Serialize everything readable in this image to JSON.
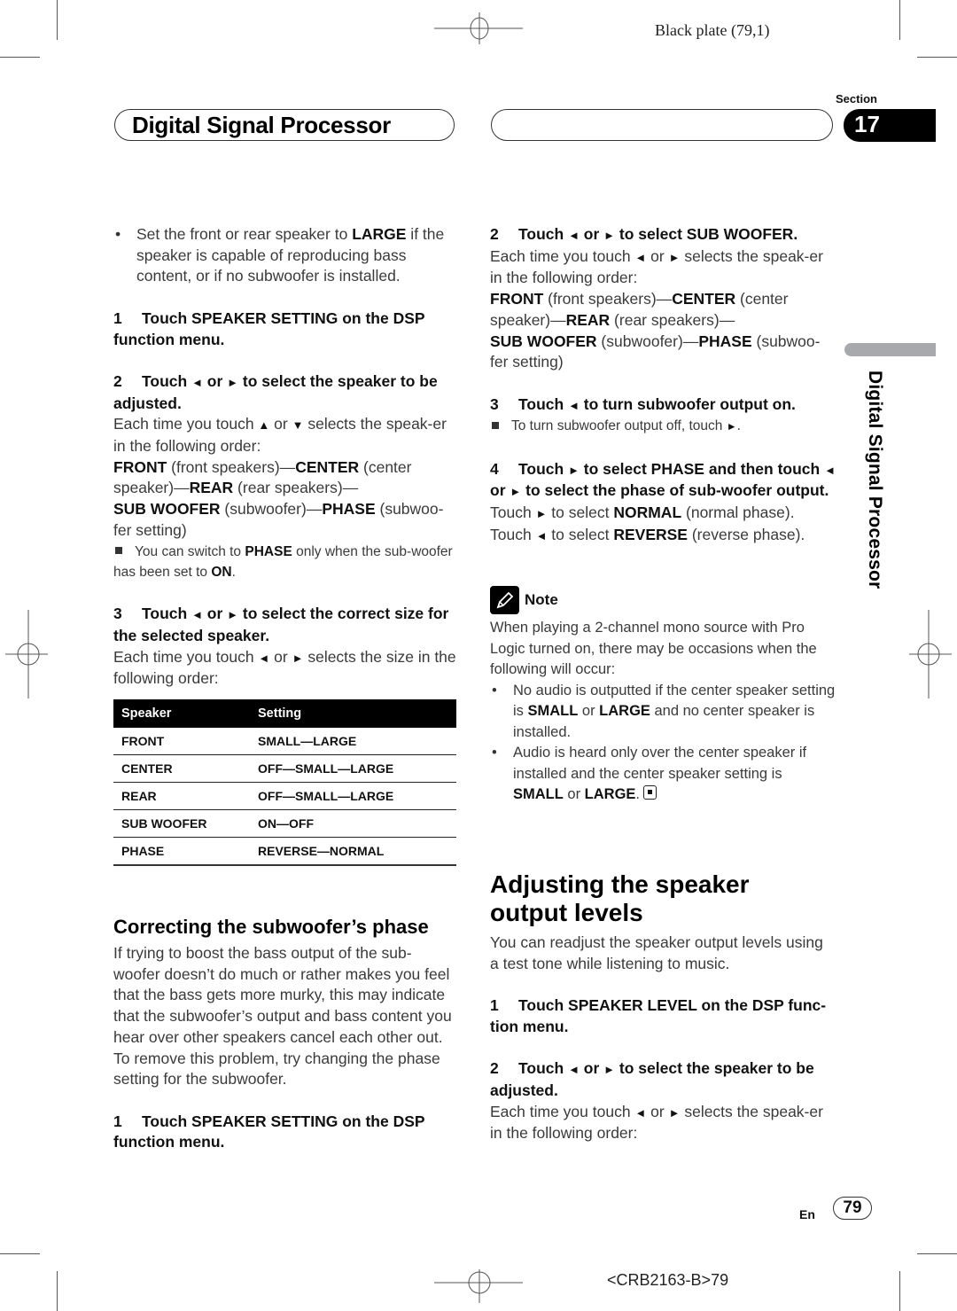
{
  "print_marks": {
    "plate": "Black plate (79,1)",
    "job_code": "<CRB2163-B>79"
  },
  "header": {
    "chapter_title": "Digital Signal Processor",
    "section_label": "Section",
    "section_number": "17",
    "side_tab_text": "Digital Signal Processor"
  },
  "left_column": {
    "intro_bullet": {
      "before": "Set the front or rear speaker to ",
      "bold": "LARGE",
      "after": " if the speaker is capable of reproducing bass content, or if no subwoofer is installed."
    },
    "step1": {
      "num": "1",
      "text": "Touch SPEAKER SETTING on the DSP function menu."
    },
    "step2": {
      "num": "2",
      "title_a": "Touch ",
      "title_b": " or ",
      "title_c": " to select the speaker to be adjusted.",
      "body_a": "Each time you touch ",
      "body_b": " or ",
      "body_c": " selects the speak-er in the following order:",
      "order": [
        {
          "bold": "FRONT",
          "text": " (front speakers)—"
        },
        {
          "bold": "CENTER",
          "text": " (center speaker)—"
        },
        {
          "bold": "REAR",
          "text": " (rear speakers)—"
        },
        {
          "bold": "SUB WOOFER",
          "text": " (subwoofer)—"
        },
        {
          "bold": "PHASE",
          "text": " (subwoo-fer setting)"
        }
      ],
      "note_a": "You can switch to ",
      "note_bold1": "PHASE",
      "note_b": " only when the sub-woofer has been set to ",
      "note_bold2": "ON",
      "note_c": "."
    },
    "step3": {
      "num": "3",
      "title_a": "Touch ",
      "title_b": " or ",
      "title_c": " to select the correct size for the selected speaker.",
      "body_a": "Each time you touch ",
      "body_b": " or ",
      "body_c": " selects the size in the following order:"
    },
    "table": {
      "headers": [
        "Speaker",
        "Setting"
      ],
      "rows": [
        [
          "FRONT",
          "SMALL—LARGE"
        ],
        [
          "CENTER",
          "OFF—SMALL—LARGE"
        ],
        [
          "REAR",
          "OFF—SMALL—LARGE"
        ],
        [
          "SUB WOOFER",
          "ON—OFF"
        ],
        [
          "PHASE",
          "REVERSE—NORMAL"
        ]
      ]
    },
    "phase_section": {
      "heading": "Correcting the subwoofer’s phase",
      "body": "If trying to boost the bass output of the sub-woofer doesn’t do much or rather makes you feel that the bass gets more murky, this may indicate that the subwoofer’s output and bass content you hear over other speakers cancel each other out. To remove this problem, try changing the phase setting for the subwoofer.",
      "step1": {
        "num": "1",
        "text": "Touch SPEAKER SETTING on the DSP function menu."
      }
    }
  },
  "right_column": {
    "step2": {
      "num": "2",
      "title_a": "Touch ",
      "title_b": " or ",
      "title_c": " to select SUB WOOFER.",
      "body_a": "Each time you touch ",
      "body_b": " or ",
      "body_c": " selects the speak-er in the following order:",
      "order": [
        {
          "bold": "FRONT",
          "text": " (front speakers)—"
        },
        {
          "bold": "CENTER",
          "text": " (center speaker)—"
        },
        {
          "bold": "REAR",
          "text": " (rear speakers)—"
        },
        {
          "bold": "SUB WOOFER",
          "text": " (subwoofer)—"
        },
        {
          "bold": "PHASE",
          "text": " (subwoo-fer setting)"
        }
      ]
    },
    "step3": {
      "num": "3",
      "title_a": "Touch ",
      "title_b": " to turn subwoofer output on.",
      "note_a": "To turn subwoofer output off, touch ",
      "note_b": "."
    },
    "step4": {
      "num": "4",
      "title_a": "Touch ",
      "title_b": " to select PHASE and then touch ",
      "title_c": " or ",
      "title_d": " to select the phase of sub-woofer output.",
      "line1_a": "Touch ",
      "line1_b": " to select ",
      "line1_bold": "NORMAL",
      "line1_c": " (normal phase).",
      "line2_a": "Touch ",
      "line2_b": " to select ",
      "line2_bold": "REVERSE",
      "line2_c": " (reverse phase)."
    },
    "note": {
      "label": "Note",
      "intro": "When playing a 2-channel mono source with Pro Logic turned on, there may be occasions when the following will occur:",
      "bullet1_a": "No audio is outputted if the center speaker setting is ",
      "bullet1_bold1": "SMALL",
      "bullet1_b": " or ",
      "bullet1_bold2": "LARGE",
      "bullet1_c": " and no center speaker is installed.",
      "bullet2_a": "Audio is heard only over the center speaker if installed and the center speaker setting is ",
      "bullet2_bold1": "SMALL",
      "bullet2_b": " or ",
      "bullet2_bold2": "LARGE",
      "bullet2_c": "."
    },
    "levels_section": {
      "heading": "Adjusting the speaker output levels",
      "body": "You can readjust the speaker output levels using a test tone while listening to music.",
      "step1": {
        "num": "1",
        "text": "Touch SPEAKER LEVEL on the DSP func-tion menu."
      },
      "step2": {
        "num": "2",
        "title_a": "Touch ",
        "title_b": " or ",
        "title_c": " to select the speaker to be adjusted.",
        "body_a": "Each time you touch ",
        "body_b": " or ",
        "body_c": " selects the speak-er in the following order:"
      }
    }
  },
  "icons": {
    "left": "◄",
    "right": "►",
    "up": "▲",
    "down": "▼"
  },
  "footer": {
    "language": "En",
    "page_number": "79"
  }
}
